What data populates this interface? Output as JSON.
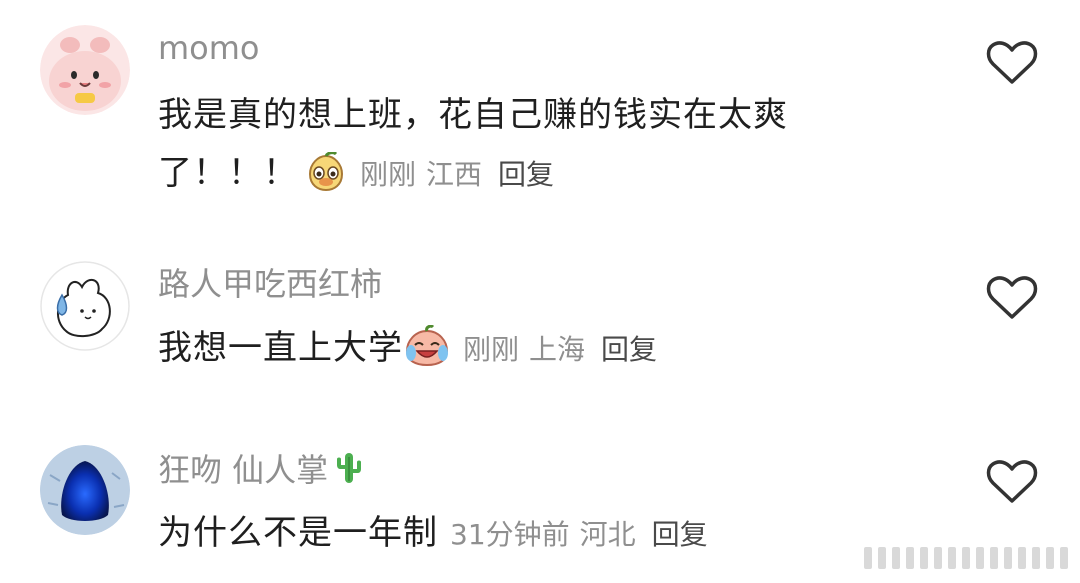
{
  "comments": [
    {
      "username": "momo",
      "text_line1": "我是真的想上班，花自己赚的钱实在太爽",
      "text_line2": "了！！！",
      "time": "刚刚",
      "location": "江西",
      "reply_label": "回复",
      "emoji": "pear-face-emoji",
      "avatar": "pink-bunny-avatar"
    },
    {
      "username": "路人甲吃西红柿",
      "text": "我想一直上大学",
      "time": "刚刚",
      "location": "上海",
      "reply_label": "回复",
      "emoji": "crying-laughing-peach-emoji",
      "avatar": "white-bunny-sketch-avatar"
    },
    {
      "username": "狂吻 仙人掌",
      "username_emoji": "cactus-emoji",
      "text": "为什么不是一年制",
      "time": "31分钟前",
      "location": "河北",
      "reply_label": "回复",
      "avatar": "blue-ice-cave-avatar"
    }
  ],
  "icons": {
    "like": "heart-outline-icon"
  },
  "colors": {
    "username": "#8f8f8f",
    "text": "#1f1f1f",
    "meta": "#8f8f8f",
    "reply": "#4a4a4a"
  }
}
